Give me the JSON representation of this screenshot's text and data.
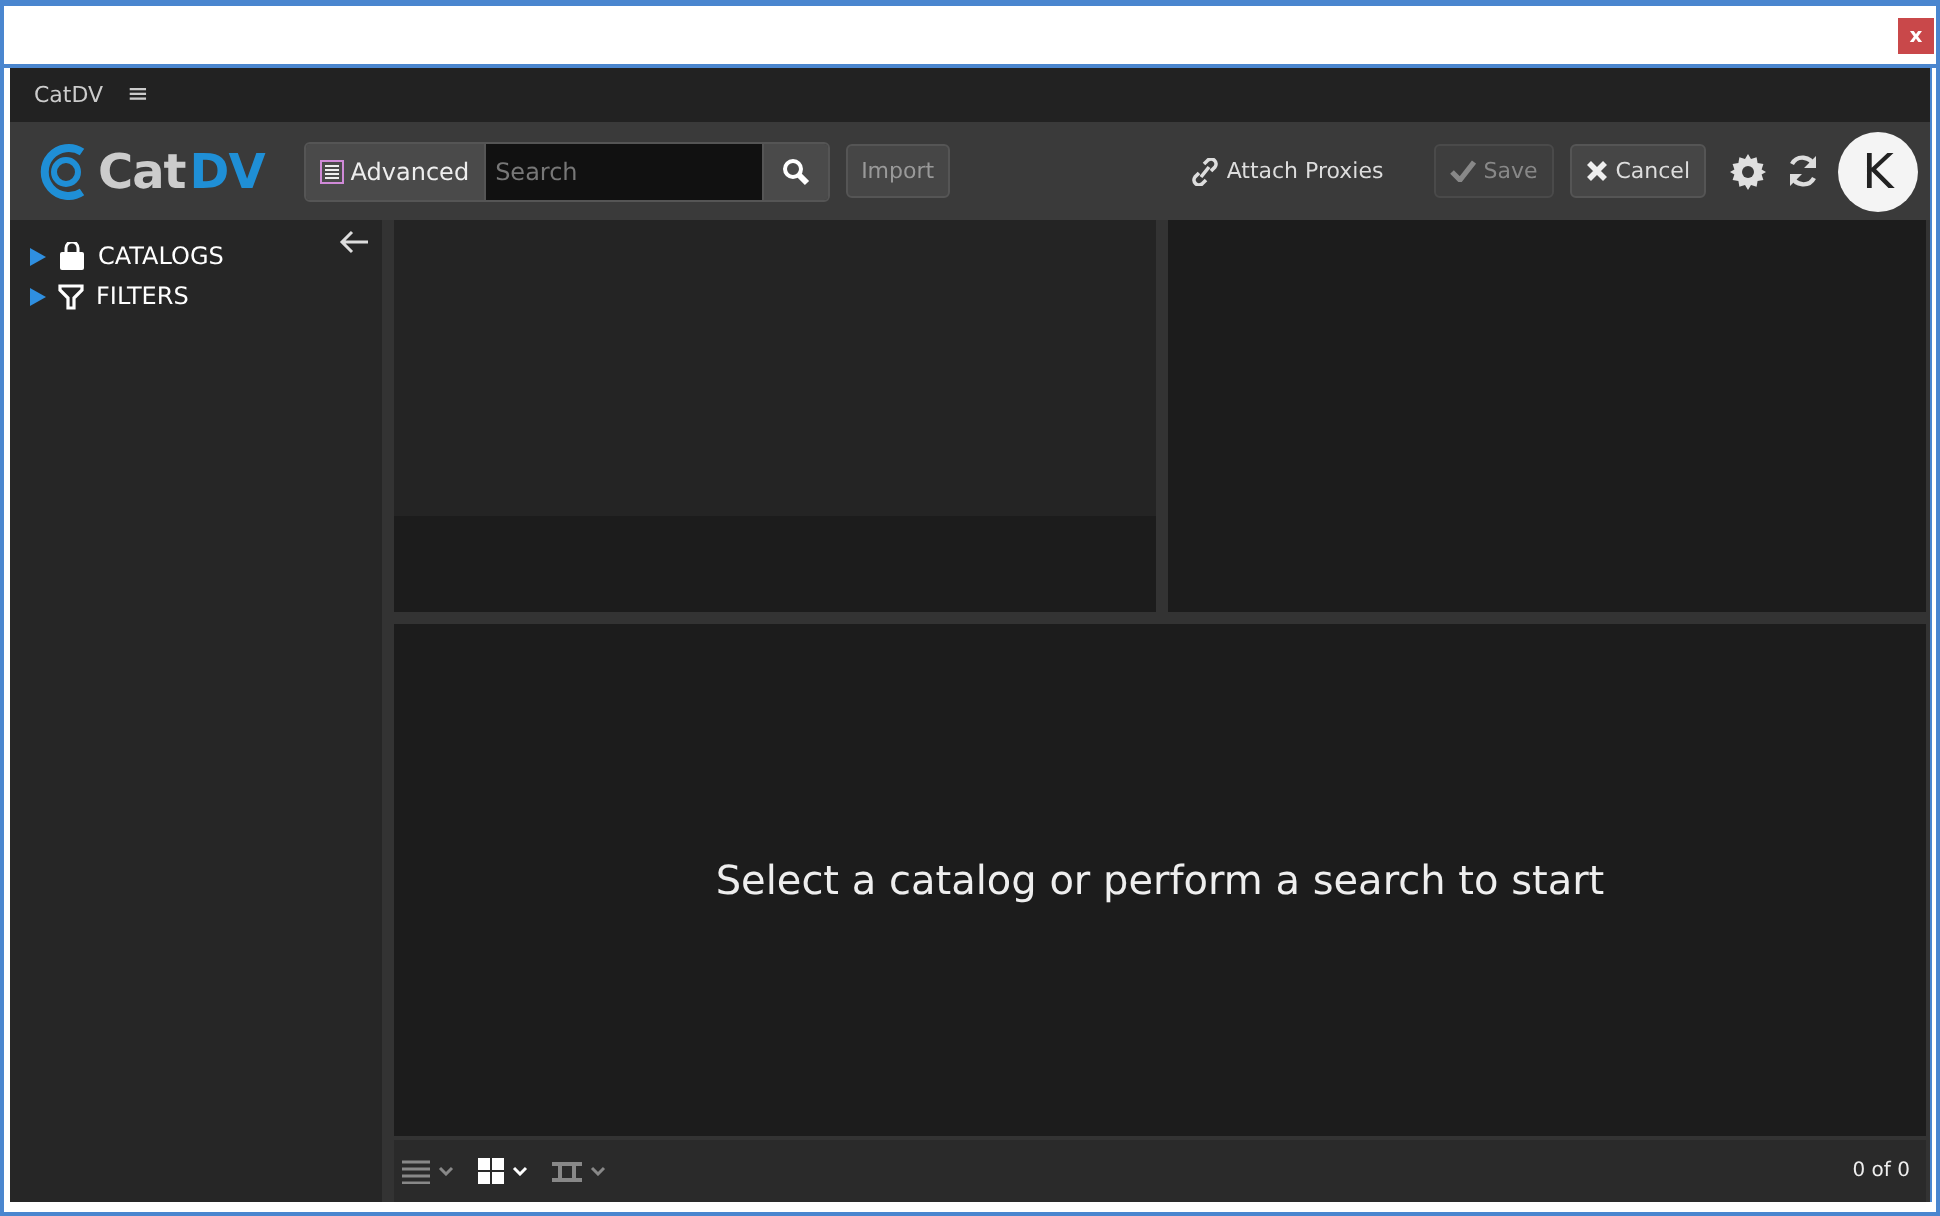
{
  "window": {
    "close": "x"
  },
  "app_bar": {
    "title": "CatDV",
    "menu": "≡"
  },
  "toolbar": {
    "logo": {
      "prefix": "Cat",
      "suffix": "DV"
    },
    "advanced": "Advanced",
    "search": {
      "placeholder": "Search"
    },
    "buttons": [
      {
        "kind": "import",
        "label": "Import",
        "disabled": false
      },
      {
        "kind": "attach",
        "label": "Attach Proxies",
        "disabled": false
      },
      {
        "kind": "save",
        "label": "Save",
        "disabled": true
      },
      {
        "kind": "cancel",
        "label": "Cancel",
        "disabled": false
      }
    ],
    "avatar": "K"
  },
  "sidebar": {
    "items": [
      {
        "kind": "catalogs",
        "label": "CATALOGS",
        "expanded": false
      },
      {
        "kind": "filters",
        "label": "FILTERS",
        "expanded": false
      }
    ]
  },
  "workspace": {
    "message": "Select a catalog or perform a search to start"
  },
  "footer": {
    "views": [
      {
        "kind": "list",
        "selected": false
      },
      {
        "kind": "grid",
        "selected": true
      },
      {
        "kind": "filmstrip",
        "selected": false
      }
    ],
    "count": "0 of 0"
  }
}
